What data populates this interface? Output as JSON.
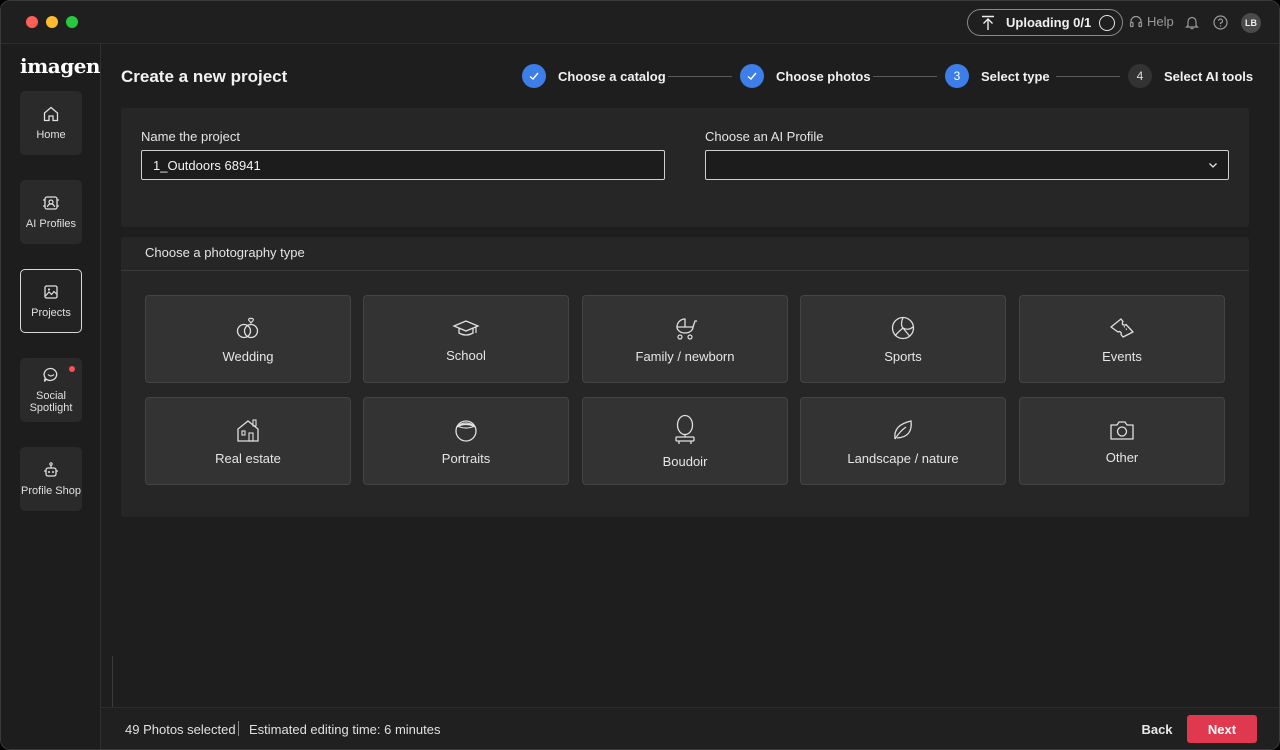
{
  "titlebar": {
    "upload_label": "Uploading 0/1",
    "help_label": "Help",
    "avatar_initials": "LB"
  },
  "sidebar": {
    "logo": "imagen",
    "items": [
      {
        "label": "Home",
        "icon": "home-icon"
      },
      {
        "label": "AI Profiles",
        "icon": "ai-profile-icon"
      },
      {
        "label": "Projects",
        "icon": "projects-icon",
        "active": true
      },
      {
        "label": "Social Spotlight",
        "icon": "chat-icon",
        "badge": true
      },
      {
        "label": "Profile Shop",
        "icon": "shop-icon"
      }
    ]
  },
  "main": {
    "title": "Create a new project",
    "steps": [
      {
        "number": "",
        "label": "Choose a catalog",
        "state": "done"
      },
      {
        "number": "",
        "label": "Choose photos",
        "state": "done"
      },
      {
        "number": "3",
        "label": "Select type",
        "state": "current"
      },
      {
        "number": "4",
        "label": "Select AI tools",
        "state": "pending"
      }
    ],
    "name_label": "Name the project",
    "name_value": "1_Outdoors 68941",
    "profile_label": "Choose an AI Profile",
    "profile_value": "",
    "type_section_title": "Choose a photography type",
    "types": [
      {
        "label": "Wedding",
        "icon": "rings-icon"
      },
      {
        "label": "School",
        "icon": "graduation-cap-icon"
      },
      {
        "label": "Family / newborn",
        "icon": "stroller-icon"
      },
      {
        "label": "Sports",
        "icon": "volleyball-icon"
      },
      {
        "label": "Events",
        "icon": "ticket-icon"
      },
      {
        "label": "Real estate",
        "icon": "house-icon"
      },
      {
        "label": "Portraits",
        "icon": "portrait-icon"
      },
      {
        "label": "Boudoir",
        "icon": "mirror-icon"
      },
      {
        "label": "Landscape / nature",
        "icon": "leaf-icon"
      },
      {
        "label": "Other",
        "icon": "camera-icon"
      }
    ]
  },
  "footer": {
    "photos_selected": "49 Photos selected",
    "estimate": "Estimated editing time: 6 minutes",
    "back_label": "Back",
    "next_label": "Next"
  },
  "colors": {
    "accent_blue": "#3d7ee8",
    "next_red": "#e0394f",
    "badge_red": "#ff4d5a"
  }
}
